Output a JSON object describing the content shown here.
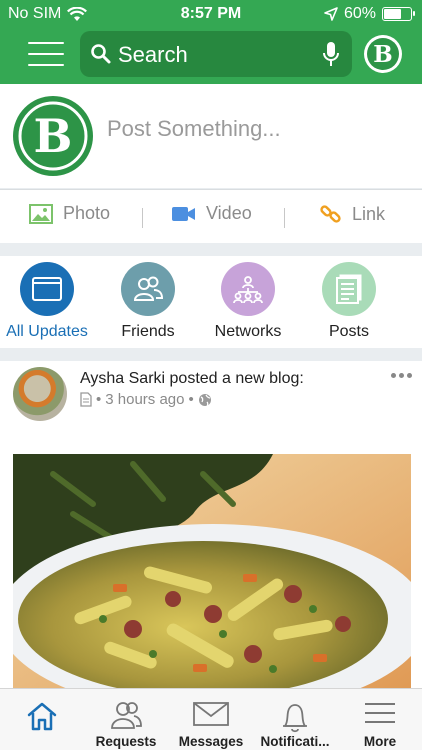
{
  "status_bar": {
    "carrier": "No SIM",
    "time": "8:57 PM",
    "battery": "60%",
    "battery_level": 0.6
  },
  "header": {
    "search_placeholder": "Search",
    "brand_letter": "B"
  },
  "composer": {
    "placeholder": "Post Something...",
    "brand_letter": "B"
  },
  "media": [
    {
      "label": "Photo",
      "icon": "photo-icon"
    },
    {
      "label": "Video",
      "icon": "video-icon"
    },
    {
      "label": "Link",
      "icon": "link-icon"
    }
  ],
  "tabs": [
    {
      "label": "All Updates",
      "icon": "all-updates-icon",
      "color": "#1a6fb5",
      "active": true
    },
    {
      "label": "Friends",
      "icon": "friends-icon",
      "color": "#6d9eab"
    },
    {
      "label": "Networks",
      "icon": "networks-icon",
      "color": "#c7a3d9"
    },
    {
      "label": "Posts",
      "icon": "posts-icon",
      "color": "#a9dbb8"
    }
  ],
  "feed": {
    "title": "Aysha Sarki posted a new blog:",
    "time": "3 hours ago"
  },
  "bottom_nav": [
    {
      "label": "",
      "icon": "home-icon"
    },
    {
      "label": "Requests",
      "icon": "requests-icon"
    },
    {
      "label": "Messages",
      "icon": "messages-icon"
    },
    {
      "label": "Notificati...",
      "icon": "notifications-icon"
    },
    {
      "label": "More",
      "icon": "more-icon"
    }
  ],
  "colors": {
    "brand_green": "#34a853",
    "accent_blue": "#1a6fb5"
  }
}
